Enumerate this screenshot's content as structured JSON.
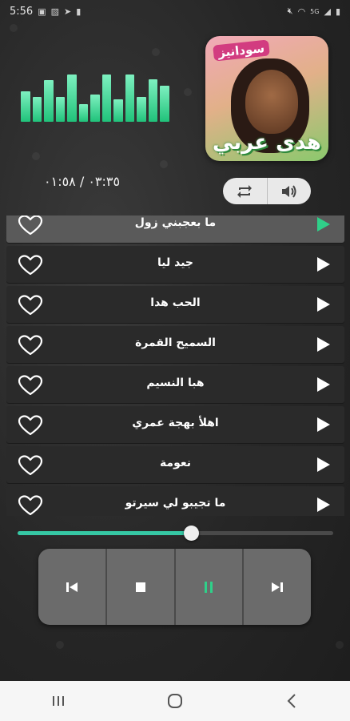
{
  "status_bar": {
    "time": "5:56",
    "left_icons": [
      "gallery-icon",
      "image-icon",
      "telegram-icon",
      "clipboard-icon"
    ],
    "network_label": "5G",
    "right_icons": [
      "mute-icon",
      "wifi-icon",
      "signal-icon",
      "battery-icon"
    ]
  },
  "equalizer": {
    "levels": [
      0.62,
      0.5,
      0.84,
      0.5,
      0.95,
      0.36,
      0.55,
      0.95,
      0.45,
      0.95,
      0.5,
      0.85,
      0.72
    ],
    "color": "#20c27a"
  },
  "cover": {
    "top_text": "سودانيز",
    "name_text": "هدى عربي",
    "image_desc": "artist-photo"
  },
  "time_readout": "٠٣:٣٥ / ٠١:٥٨",
  "controls": {
    "repeat_icon": "repeat-icon",
    "volume_icon": "volume-icon"
  },
  "tracks": [
    {
      "title": "ما بعجبني زول",
      "active": true
    },
    {
      "title": "جيد ليا",
      "active": false
    },
    {
      "title": "الحب هدا",
      "active": false
    },
    {
      "title": "السميح القمرة",
      "active": false
    },
    {
      "title": "هبا النسيم",
      "active": false
    },
    {
      "title": "اهلأ بهجة عمري",
      "active": false
    },
    {
      "title": "نعومة",
      "active": false
    },
    {
      "title": "ما تجيبو لي سيرتو",
      "active": false
    }
  ],
  "progress": {
    "fraction": 0.55,
    "accent": "#36c7a4"
  },
  "player": {
    "buttons": [
      "previous-icon",
      "stop-icon",
      "pause-icon",
      "next-icon"
    ],
    "pause_color": "#2fd089"
  },
  "nav": [
    "recents-icon",
    "home-icon",
    "back-icon"
  ]
}
